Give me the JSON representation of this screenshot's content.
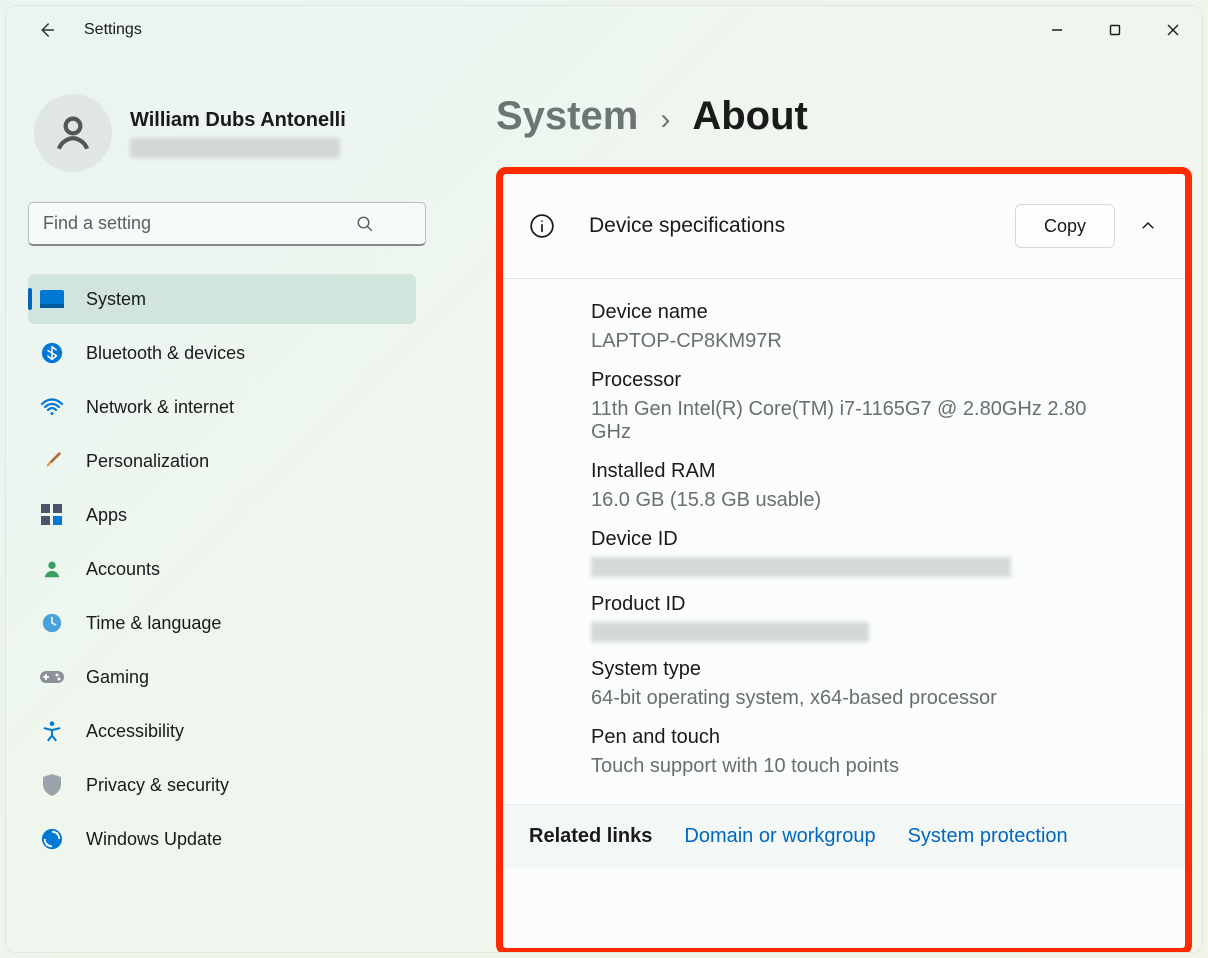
{
  "window": {
    "title": "Settings"
  },
  "user": {
    "name": "William Dubs Antonelli"
  },
  "search": {
    "placeholder": "Find a setting"
  },
  "nav": {
    "items": [
      {
        "label": "System"
      },
      {
        "label": "Bluetooth & devices"
      },
      {
        "label": "Network & internet"
      },
      {
        "label": "Personalization"
      },
      {
        "label": "Apps"
      },
      {
        "label": "Accounts"
      },
      {
        "label": "Time & language"
      },
      {
        "label": "Gaming"
      },
      {
        "label": "Accessibility"
      },
      {
        "label": "Privacy & security"
      },
      {
        "label": "Windows Update"
      }
    ]
  },
  "breadcrumb": {
    "parent": "System",
    "separator": "›",
    "current": "About"
  },
  "card": {
    "title": "Device specifications",
    "copy_label": "Copy"
  },
  "specs": {
    "device_name_label": "Device name",
    "device_name_value": "LAPTOP-CP8KM97R",
    "processor_label": "Processor",
    "processor_value": "11th Gen Intel(R) Core(TM) i7-1165G7 @ 2.80GHz   2.80 GHz",
    "ram_label": "Installed RAM",
    "ram_value": "16.0 GB (15.8 GB usable)",
    "device_id_label": "Device ID",
    "product_id_label": "Product ID",
    "system_type_label": "System type",
    "system_type_value": "64-bit operating system, x64-based processor",
    "pen_touch_label": "Pen and touch",
    "pen_touch_value": "Touch support with 10 touch points"
  },
  "related": {
    "label": "Related links",
    "link1": "Domain or workgroup",
    "link2": "System protection"
  }
}
